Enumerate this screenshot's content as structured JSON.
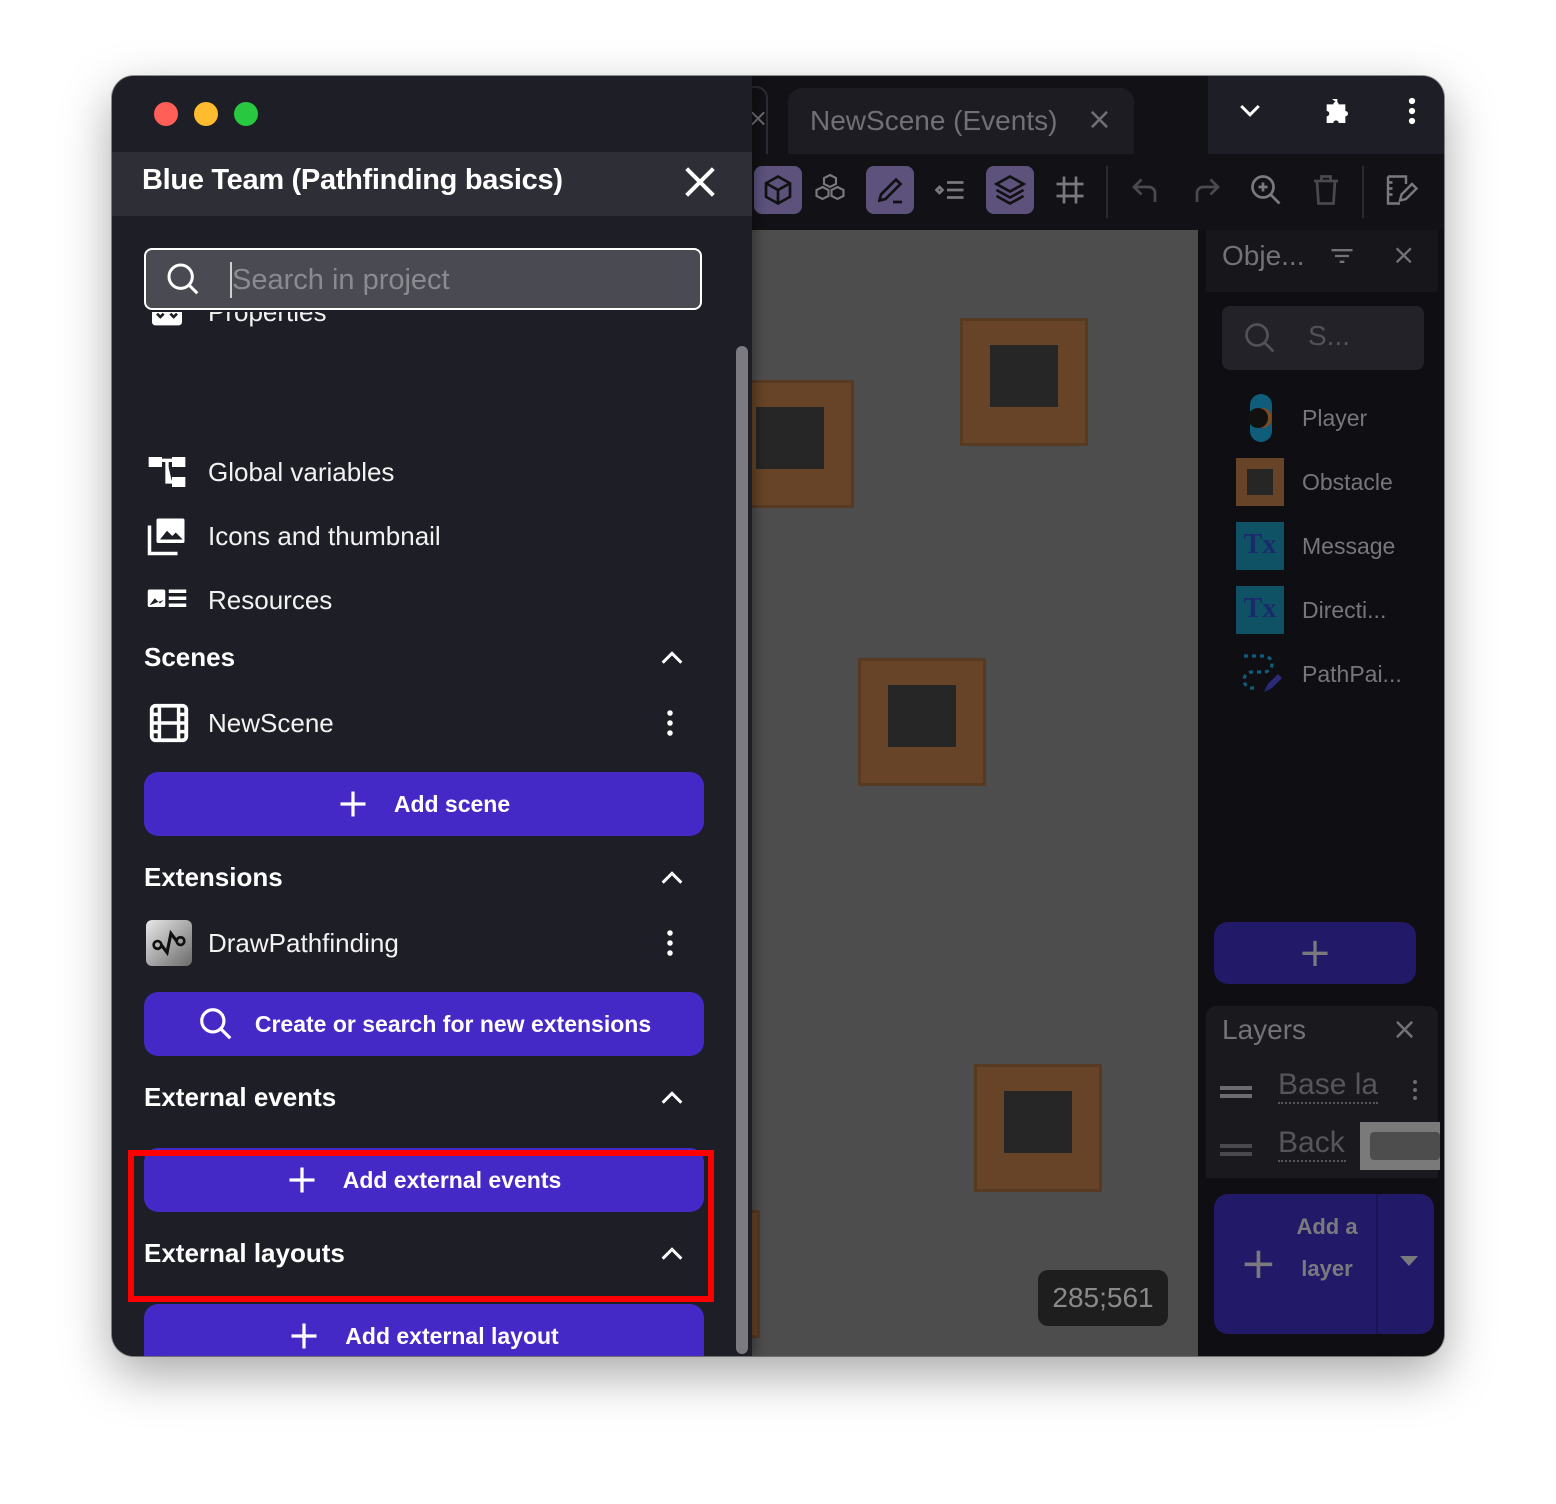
{
  "window": {
    "traffic_lights": [
      {
        "name": "close",
        "color": "#ff5f57"
      },
      {
        "name": "minimize",
        "color": "#febc2e"
      },
      {
        "name": "zoom",
        "color": "#28c840"
      }
    ]
  },
  "drawer": {
    "title": "Blue Team (Pathfinding basics)",
    "search_placeholder": "Search in project",
    "search_value": "",
    "project_items": [
      {
        "label": "Properties",
        "icon": "properties-icon"
      },
      {
        "label": "Global variables",
        "icon": "global-variables-icon"
      },
      {
        "label": "Icons and thumbnail",
        "icon": "image-icon"
      },
      {
        "label": "Resources",
        "icon": "resources-icon"
      }
    ],
    "sections": {
      "scenes": {
        "label": "Scenes",
        "items": [
          "NewScene"
        ],
        "add_label": "Add scene"
      },
      "extensions": {
        "label": "Extensions",
        "items": [
          "DrawPathfinding"
        ],
        "add_label": "Create or search for new extensions"
      },
      "external_events": {
        "label": "External events",
        "add_label": "Add external events"
      },
      "external_layouts": {
        "label": "External layouts",
        "add_label": "Add external layout"
      }
    },
    "accent_color": "#4529c6",
    "highlight_color": "#ff0000"
  },
  "editor": {
    "tabs": [
      {
        "label": "NewScene (Events)",
        "active": false
      }
    ],
    "coordinates": "285;561",
    "objects_panel": {
      "title": "Obje...",
      "search_placeholder": "S...",
      "items": [
        {
          "name": "Player"
        },
        {
          "name": "Obstacle"
        },
        {
          "name": "Message"
        },
        {
          "name": "Directi..."
        },
        {
          "name": "PathPai..."
        }
      ],
      "add_label": "+"
    },
    "layers_panel": {
      "title": "Layers",
      "layers": [
        "Base la",
        "Back"
      ],
      "add_label": "Add a layer"
    }
  }
}
